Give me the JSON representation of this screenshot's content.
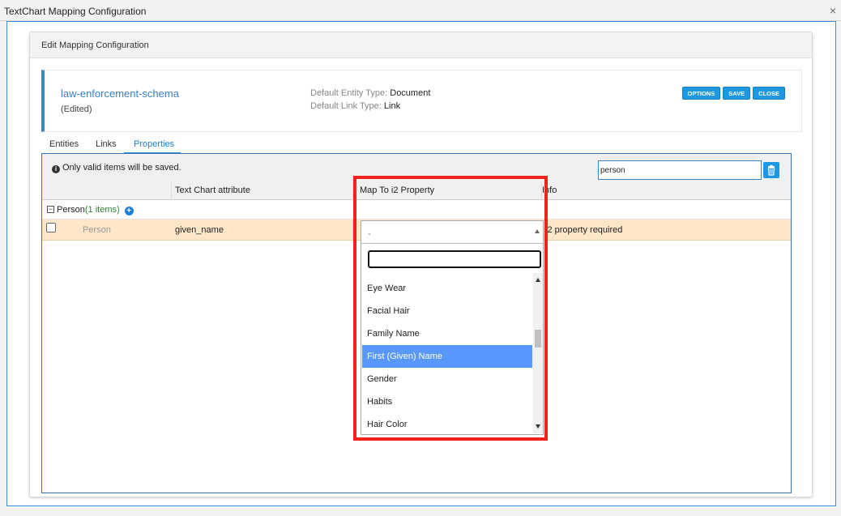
{
  "window": {
    "title": "TextChart Mapping Configuration",
    "close_glyph": "×"
  },
  "panel": {
    "title": "Edit Mapping Configuration"
  },
  "schema": {
    "name": "law-enforcement-schema",
    "status": "(Edited)",
    "default_entity_label": "Default Entity Type:",
    "default_entity_value": "Document",
    "default_link_label": "Default Link Type:",
    "default_link_value": "Link"
  },
  "buttons": {
    "options": "OPTIONS",
    "save": "SAVE",
    "close": "CLOSE"
  },
  "tabs": [
    {
      "label": "Entities"
    },
    {
      "label": "Links"
    },
    {
      "label": "Properties",
      "active": true
    }
  ],
  "toolbar": {
    "note": "Only valid items will be saved.",
    "filter_value": "person"
  },
  "columns": {
    "attr": "Text Chart attribute",
    "map": "Map To i2 Property",
    "info": "Info"
  },
  "group": {
    "name": "Person",
    "count": "(1 items)"
  },
  "row": {
    "type": "Person",
    "attribute": "given_name",
    "info": "i2 property required"
  },
  "dropdown": {
    "selected_value": "-",
    "search_value": "",
    "items": [
      "Eye Wear",
      "Facial Hair",
      "Family Name",
      "First (Given) Name",
      "Gender",
      "Habits",
      "Hair Color"
    ],
    "highlighted_index": 3
  },
  "colors": {
    "accent": "#1e98e0",
    "row_highlight": "#fde7c8",
    "selection": "#5897fb",
    "annotation": "#f0221c"
  }
}
